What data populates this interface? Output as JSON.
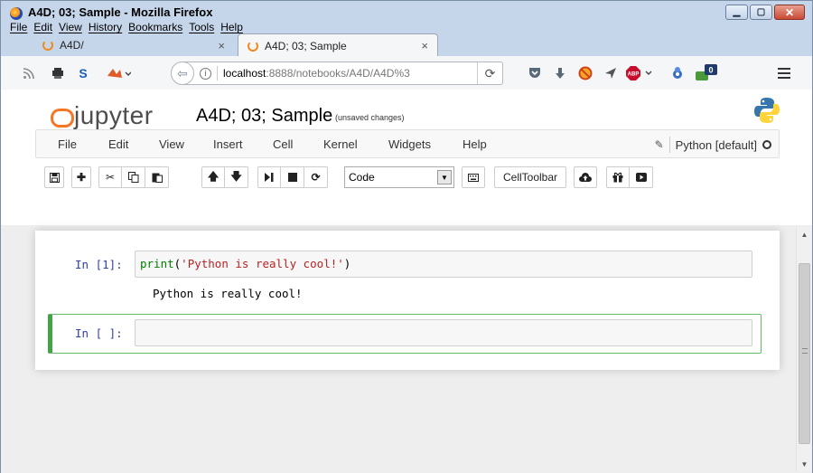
{
  "window": {
    "title": "A4D; 03; Sample - Mozilla Firefox",
    "menu": [
      "File",
      "Edit",
      "View",
      "History",
      "Bookmarks",
      "Tools",
      "Help"
    ]
  },
  "tabs": [
    {
      "label": "A4D/",
      "active": false
    },
    {
      "label": "A4D; 03; Sample",
      "active": true
    }
  ],
  "tab_close_glyph": "×",
  "urlbar": {
    "host": "localhost",
    "path": ":8888/notebooks/A4D/A4D%3"
  },
  "badges": {
    "pocket_count": "0",
    "abp_label": "ABP"
  },
  "jupyter": {
    "logo_text": "jupyter",
    "notebook_title": "A4D; 03; Sample",
    "save_status": "(unsaved changes)",
    "menu": [
      "File",
      "Edit",
      "View",
      "Insert",
      "Cell",
      "Kernel",
      "Widgets",
      "Help"
    ],
    "kernel_name": "Python [default]",
    "cell_type": "Code",
    "celltoolbar_label": "CellToolbar"
  },
  "cells": [
    {
      "prompt": "In [1]:",
      "code_func": "print",
      "code_open": "(",
      "code_string": "'Python is really cool!'",
      "code_close": ")",
      "output": "Python is really cool!"
    },
    {
      "prompt": "In [ ]:",
      "code": "",
      "output": ""
    }
  ],
  "colors": {
    "jupyter_orange": "#f37726",
    "selected_cell_border": "#42a545",
    "prompt_blue": "#303f9f"
  }
}
